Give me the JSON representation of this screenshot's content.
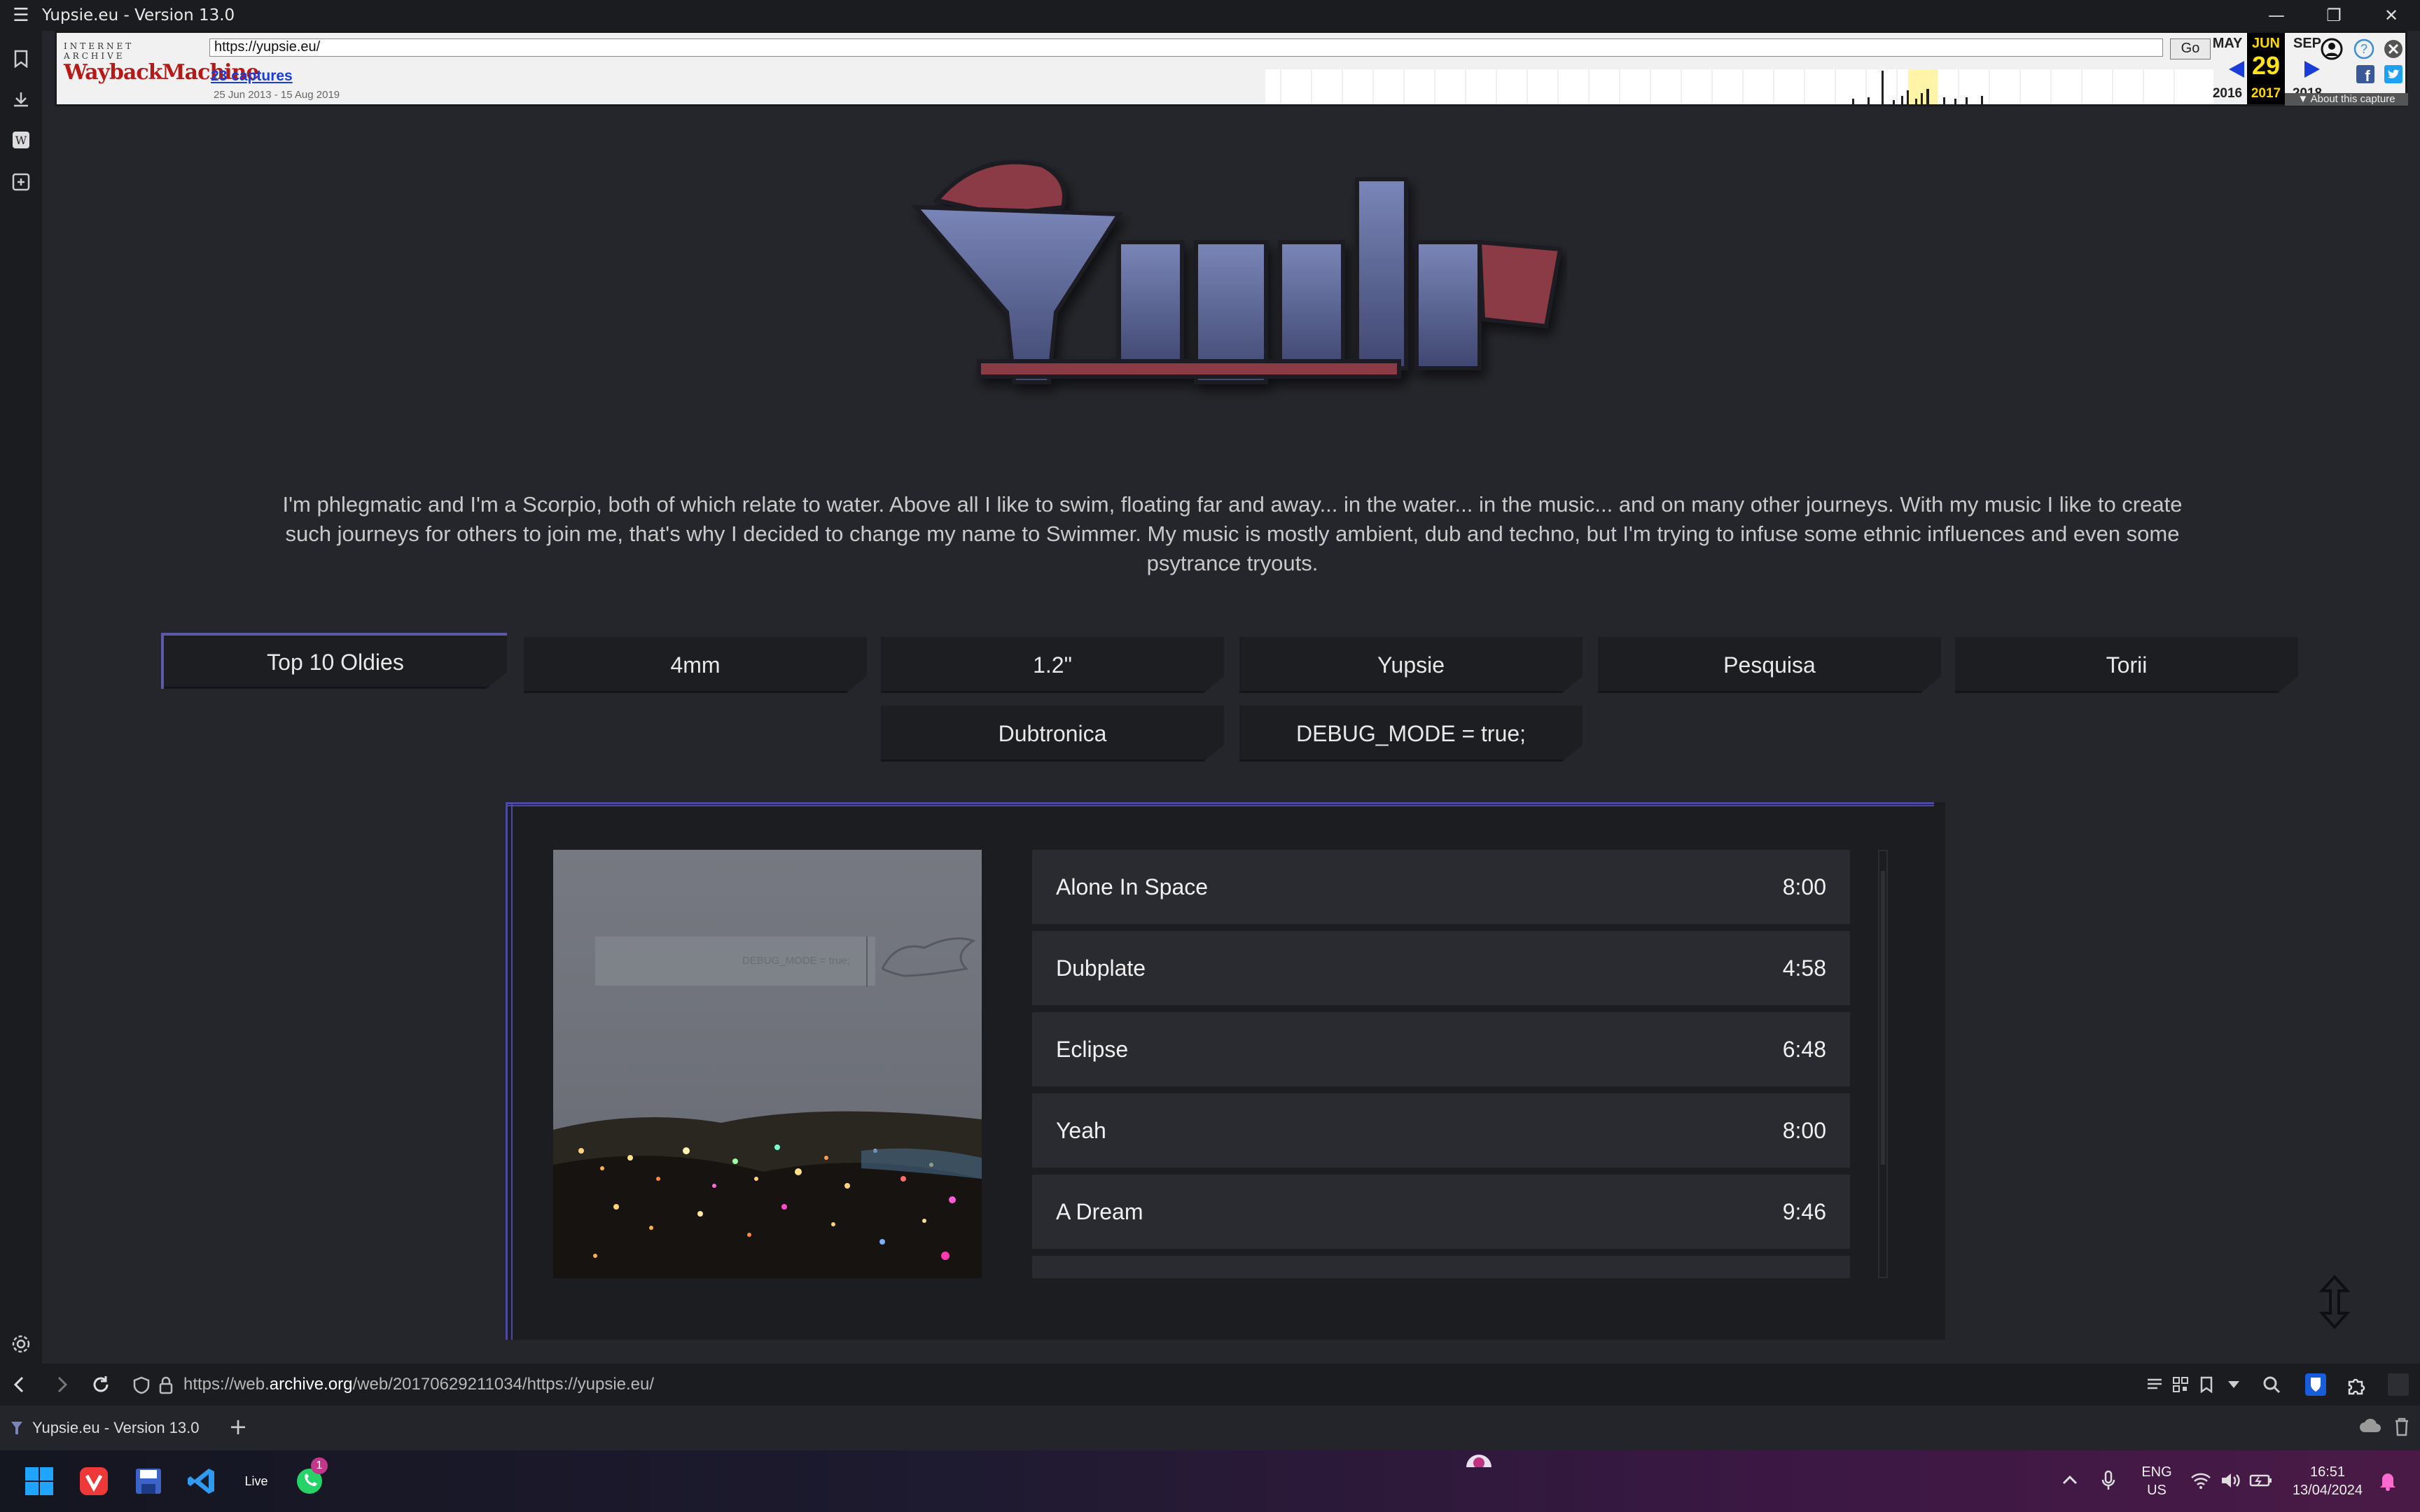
{
  "window": {
    "title": "Yupsie.eu - Version 13.0"
  },
  "wayback": {
    "logo_top": "INTERNET ARCHIVE",
    "logo_main": "WaybackMachine",
    "url": "https://yupsie.eu/",
    "go_label": "Go",
    "captures": "23 captures",
    "date_range": "25 Jun 2013 - 15 Aug 2019",
    "prev_month": "MAY",
    "prev_year": "2016",
    "cur_month": "JUN",
    "cur_day": "29",
    "cur_year": "2017",
    "next_month": "SEP",
    "next_year": "2018",
    "about": "About this capture"
  },
  "site": {
    "bio": "I'm phlegmatic and I'm a Scorpio, both of which relate to water. Above all I like to swim, floating far and away... in the water... in the music... and on many other journeys. With my music I like to create such journeys for others to join me, that's why I decided to change my name to Swimmer. My music is mostly ambient, dub and techno, but I'm trying to infuse some ethnic influences and even some psytrance tryouts.",
    "tabs": [
      {
        "label": "Top 10 Oldies"
      },
      {
        "label": "4mm"
      },
      {
        "label": "1.2\""
      },
      {
        "label": "Yupsie"
      },
      {
        "label": "Pesquisa"
      },
      {
        "label": "Torii"
      },
      {
        "label": "Dubtronica"
      },
      {
        "label": "DEBUG_MODE = true;"
      }
    ],
    "cover_caption": "DEBUG_MODE = true;",
    "tracks": [
      {
        "title": "Alone In Space",
        "duration": "8:00"
      },
      {
        "title": "Dubplate",
        "duration": "4:58"
      },
      {
        "title": "Eclipse",
        "duration": "6:48"
      },
      {
        "title": "Yeah",
        "duration": "8:00"
      },
      {
        "title": "A Dream",
        "duration": "9:46"
      }
    ]
  },
  "browser": {
    "address_prefix": "https://web.",
    "address_domain": "archive.org",
    "address_suffix": "/web/20170629211034/https://yupsie.eu/",
    "tab_title": "Yupsie.eu - Version 13.0",
    "new_tab": "+"
  },
  "taskbar": {
    "live_label": "Live",
    "whatsapp_badge": "1",
    "lang_top": "ENG",
    "lang_bottom": "US",
    "time": "16:51",
    "date": "13/04/2024"
  },
  "colors": {
    "page_bg": "#25262b",
    "accent": "#4d4ba0",
    "wayback_red": "#b51a18",
    "wayback_highlight": "#ffd800"
  }
}
